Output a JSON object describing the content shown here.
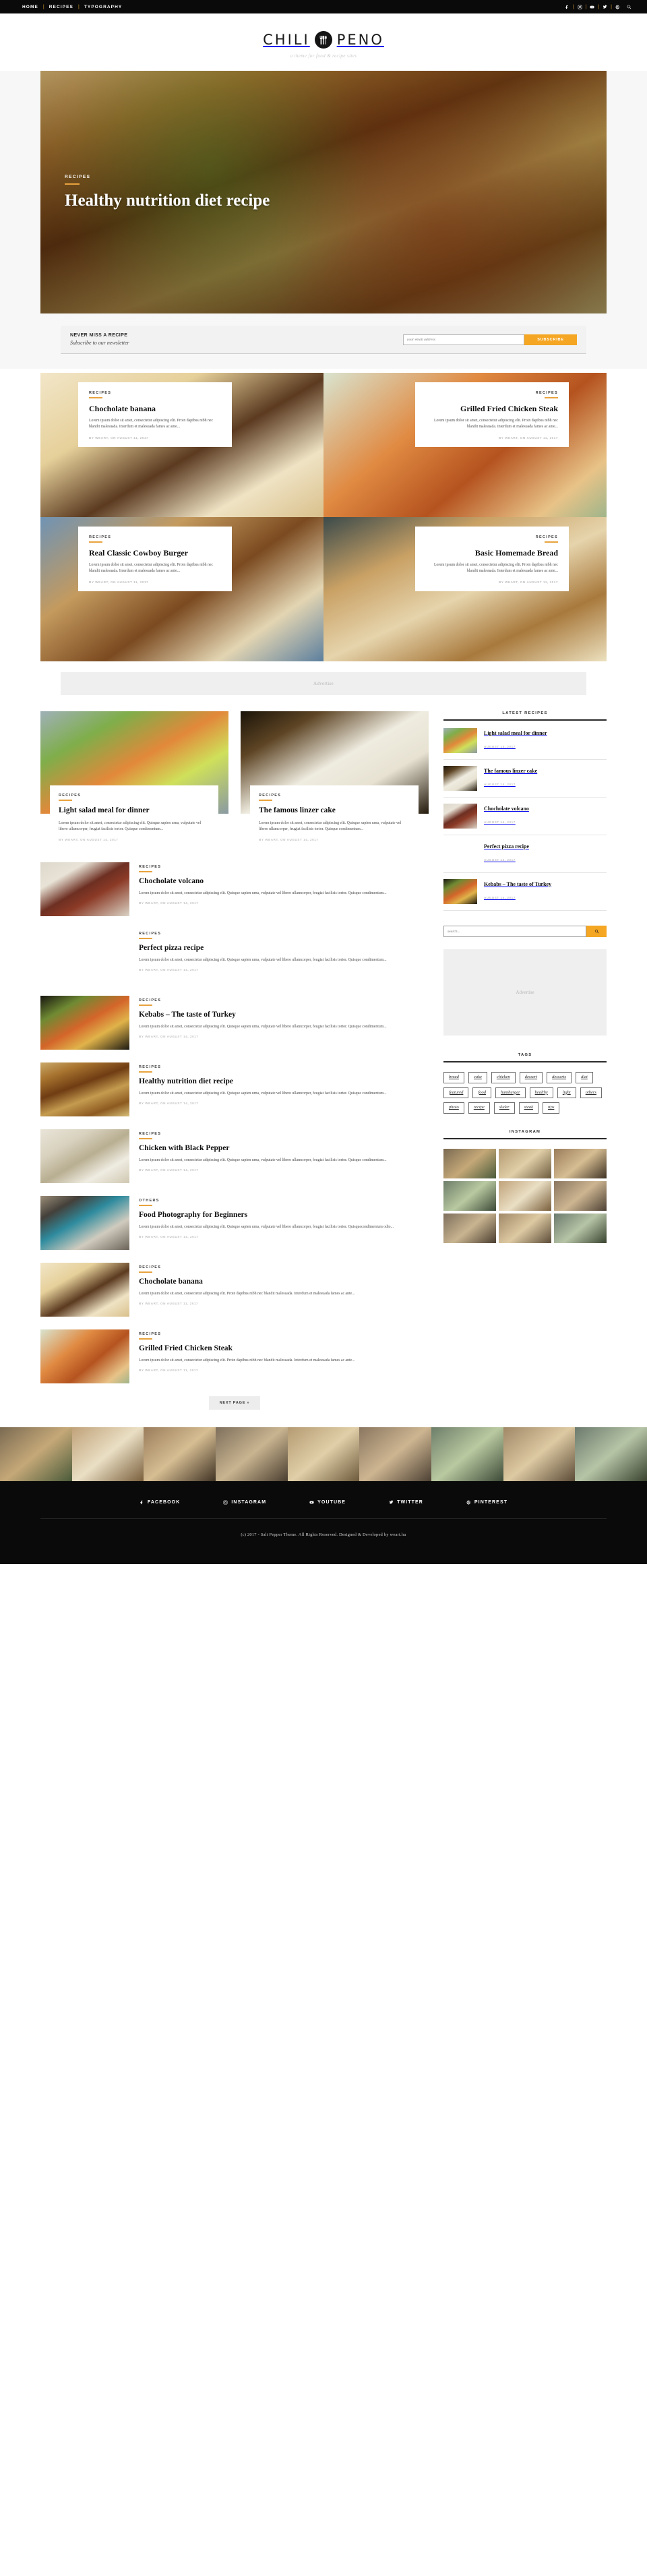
{
  "topbar": {
    "nav": [
      {
        "label": "HOME"
      },
      {
        "label": "RECIPES"
      },
      {
        "label": "TYPOGRAPHY"
      }
    ],
    "separator": "|",
    "social": [
      {
        "name": "facebook-icon",
        "label": "Facebook"
      },
      {
        "name": "instagram-icon",
        "label": "Instagram"
      },
      {
        "name": "youtube-icon",
        "label": "YouTube"
      },
      {
        "name": "twitter-icon",
        "label": "Twitter"
      },
      {
        "name": "pinterest-icon",
        "label": "Pinterest"
      },
      {
        "name": "search-icon",
        "label": "Search"
      }
    ]
  },
  "header": {
    "logo_left": "CHILI",
    "logo_right": "PENO",
    "tagline": "a theme for food & recipe sites"
  },
  "hero": {
    "category": "RECIPES",
    "title": "Healthy nutrition diet recipe"
  },
  "newsletter": {
    "title": "NEVER MISS A RECIPE",
    "subtitle": "Subscribe to our newsletter",
    "placeholder": "your email address",
    "button": "SUBSCRIBE"
  },
  "featured": [
    {
      "category": "RECIPES",
      "title": "Chocholate banana",
      "excerpt": "Lorem ipsum dolor sit amet, consectetur adipiscing elit. Proin dapibus nibh nec blandit malesuada. Interdum et malesuada fames ac ante...",
      "meta": "BY WEART, ON AUGUST 11, 2017",
      "align": "left"
    },
    {
      "category": "RECIPES",
      "title": "Grilled Fried Chicken Steak",
      "excerpt": "Lorem ipsum dolor sit amet, consectetur adipiscing elit. Proin dapibus nibh nec blandit malesuada. Interdum et malesuada fames ac ante...",
      "meta": "BY WEART, ON AUGUST 11, 2017",
      "align": "right"
    },
    {
      "category": "RECIPES",
      "title": "Real Classic Cowboy Burger",
      "excerpt": "Lorem ipsum dolor sit amet, consectetur adipiscing elit. Proin dapibus nibh nec blandit malesuada. Interdum et malesuada fames ac ante...",
      "meta": "BY WEART, ON AUGUST 11, 2017",
      "align": "left"
    },
    {
      "category": "RECIPES",
      "title": "Basic Homemade Bread",
      "excerpt": "Lorem ipsum dolor sit amet, consectetur adipiscing elit. Proin dapibus nibh nec blandit malesuada. Interdum et malesuada fames ac ante...",
      "meta": "BY WEART, ON AUGUST 11, 2017",
      "align": "right"
    }
  ],
  "advertise": {
    "top_label": "Advertise",
    "side_label": "Advertise"
  },
  "grid_posts": [
    {
      "category": "RECIPES",
      "title": "Light salad meal for dinner",
      "excerpt": "Lorem ipsum dolor sit amet, consectetur adipiscing elit. Quisque sapien urna, vulputate vel libero ullamcorper, feugiat facilisis tortor. Quisque condimentum...",
      "meta": "BY WEART, ON AUGUST 14, 2017"
    },
    {
      "category": "RECIPES",
      "title": "The famous linzer cake",
      "excerpt": "Lorem ipsum dolor sit amet, consectetur adipiscing elit. Quisque sapien urna, vulputate vel libero ullamcorper, feugiat facilisis tortor. Quisque condimentum...",
      "meta": "BY WEART, ON AUGUST 14, 2017"
    }
  ],
  "list_posts": [
    {
      "category": "RECIPES",
      "title": "Chocholate volcano",
      "excerpt": "Lorem ipsum dolor sit amet, consectetur adipiscing elit. Quisque sapien urna, vulputate vel libero ullamcorper, feugiat facilisis tortor. Quisque condimentum...",
      "meta": "BY WEART, ON AUGUST 14, 2017"
    },
    {
      "category": "RECIPES",
      "title": "Perfect pizza recipe",
      "excerpt": "Lorem ipsum dolor sit amet, consectetur adipiscing elit. Quisque sapien urna, vulputate vel libero ullamcorper, feugiat facilisis tortor. Quisque condimentum...",
      "meta": "BY WEART, ON AUGUST 14, 2017"
    },
    {
      "category": "RECIPES",
      "title": "Kebabs – The taste of Turkey",
      "excerpt": "Lorem ipsum dolor sit amet, consectetur adipiscing elit. Quisque sapien urna, vulputate vel libero ullamcorper, feugiat facilisis tortor. Quisque condimentum...",
      "meta": "BY WEART, ON AUGUST 14, 2017"
    },
    {
      "category": "RECIPES",
      "title": "Healthy nutrition diet recipe",
      "excerpt": "Lorem ipsum dolor sit amet, consectetur adipiscing elit. Quisque sapien urna, vulputate vel libero ullamcorper, feugiat facilisis tortor. Quisque condimentum...",
      "meta": "BY WEART, ON AUGUST 14, 2017"
    },
    {
      "category": "RECIPES",
      "title": "Chicken with Black Pepper",
      "excerpt": "Lorem ipsum dolor sit amet, consectetur adipiscing elit. Quisque sapien urna, vulputate vel libero ullamcorper, feugiat facilisis tortor. Quisque condimentum...",
      "meta": "BY WEART, ON AUGUST 14, 2017"
    },
    {
      "category": "OTHERS",
      "title": "Food Photography for Beginners",
      "excerpt": "Lorem ipsum dolor sit amet, consectetur adipiscing elit. Quisque sapien urna, vulputate vel libero ullamcorper, feugiat facilisis tortor. Quisquecondimentum odio...",
      "meta": "BY WEART, ON AUGUST 14, 2017"
    },
    {
      "category": "RECIPES",
      "title": "Chocholate banana",
      "excerpt": "Lorem ipsum dolor sit amet, consectetur adipiscing elit. Proin dapibus nibh nec blandit malesuada. Interdum et malesuada fames ac ante...",
      "meta": "BY WEART, ON AUGUST 11, 2017"
    },
    {
      "category": "RECIPES",
      "title": "Grilled Fried Chicken Steak",
      "excerpt": "Lorem ipsum dolor sit amet, consectetur adipiscing elit. Proin dapibus nibh nec blandit malesuada. Interdum et malesuada fames ac ante...",
      "meta": "BY WEART, ON AUGUST 11, 2017"
    }
  ],
  "pagination": {
    "next_label": "NEXT PAGE »"
  },
  "sidebar": {
    "latest_title": "LATEST RECIPES",
    "latest": [
      {
        "title": "Light salad meal for dinner",
        "date": "AUGUST 14, 2017"
      },
      {
        "title": "The famous linzer cake",
        "date": "AUGUST 14, 2017"
      },
      {
        "title": "Chocholate volcano",
        "date": "AUGUST 14, 2017"
      },
      {
        "title": "Perfect pizza recipe",
        "date": "AUGUST 14, 2017"
      },
      {
        "title": "Kebabs – The taste of Turkey",
        "date": "AUGUST 14, 2017"
      }
    ],
    "search_placeholder": "search...",
    "tags_title": "TAGS",
    "tags": [
      "bread",
      "cake",
      "chicken",
      "dessert",
      "desserts",
      "diet",
      "featured",
      "food",
      "hamburger",
      "healthy",
      "light",
      "others",
      "photo",
      "recipe",
      "slider",
      "steak",
      "tips"
    ],
    "instagram_title": "INSTAGRAM"
  },
  "footer": {
    "social": [
      {
        "name": "facebook-icon",
        "label": "FACEBOOK"
      },
      {
        "name": "instagram-icon",
        "label": "INSTAGRAM"
      },
      {
        "name": "youtube-icon",
        "label": "YOUTUBE"
      },
      {
        "name": "twitter-icon",
        "label": "TWITTER"
      },
      {
        "name": "pinterest-icon",
        "label": "PINTEREST"
      }
    ],
    "copyright": "(c) 2017 - Salt Pepper Theme. All Rights Reserved. Designed & Developed by weart.hu"
  },
  "colors": {
    "accent": "#f5a623",
    "dark": "#0a0a0a",
    "muted": "#c2c2c2"
  }
}
